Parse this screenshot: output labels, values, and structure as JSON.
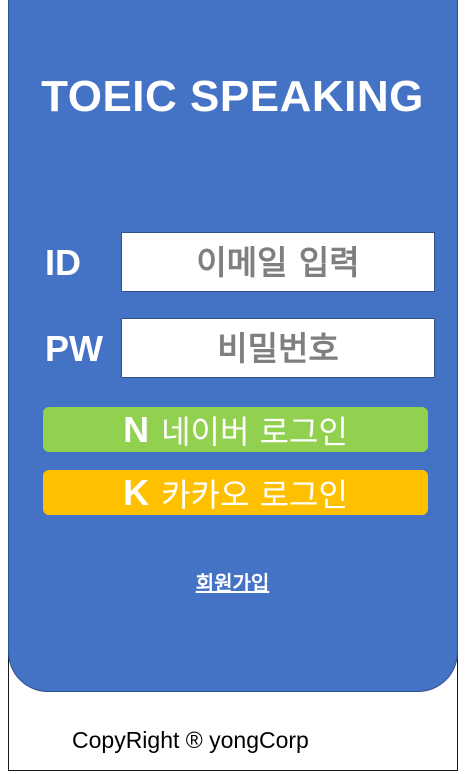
{
  "app": {
    "title": "TOEIC SPEAKING"
  },
  "login": {
    "id_label": "ID",
    "id_placeholder": "이메일 입력",
    "pw_label": "PW",
    "pw_placeholder": "비밀번호"
  },
  "buttons": {
    "naver_mark": "N",
    "naver_label": "네이버 로그인",
    "kakao_mark": "K",
    "kakao_label": "카카오 로그인"
  },
  "signup": {
    "label": "회원가입"
  },
  "footer": {
    "copyright": "CopyRight ® yongCorp"
  },
  "colors": {
    "panel": "#4472c4",
    "naver": "#92d050",
    "kakao": "#ffc000",
    "placeholder_text": "#7f7f7f"
  }
}
